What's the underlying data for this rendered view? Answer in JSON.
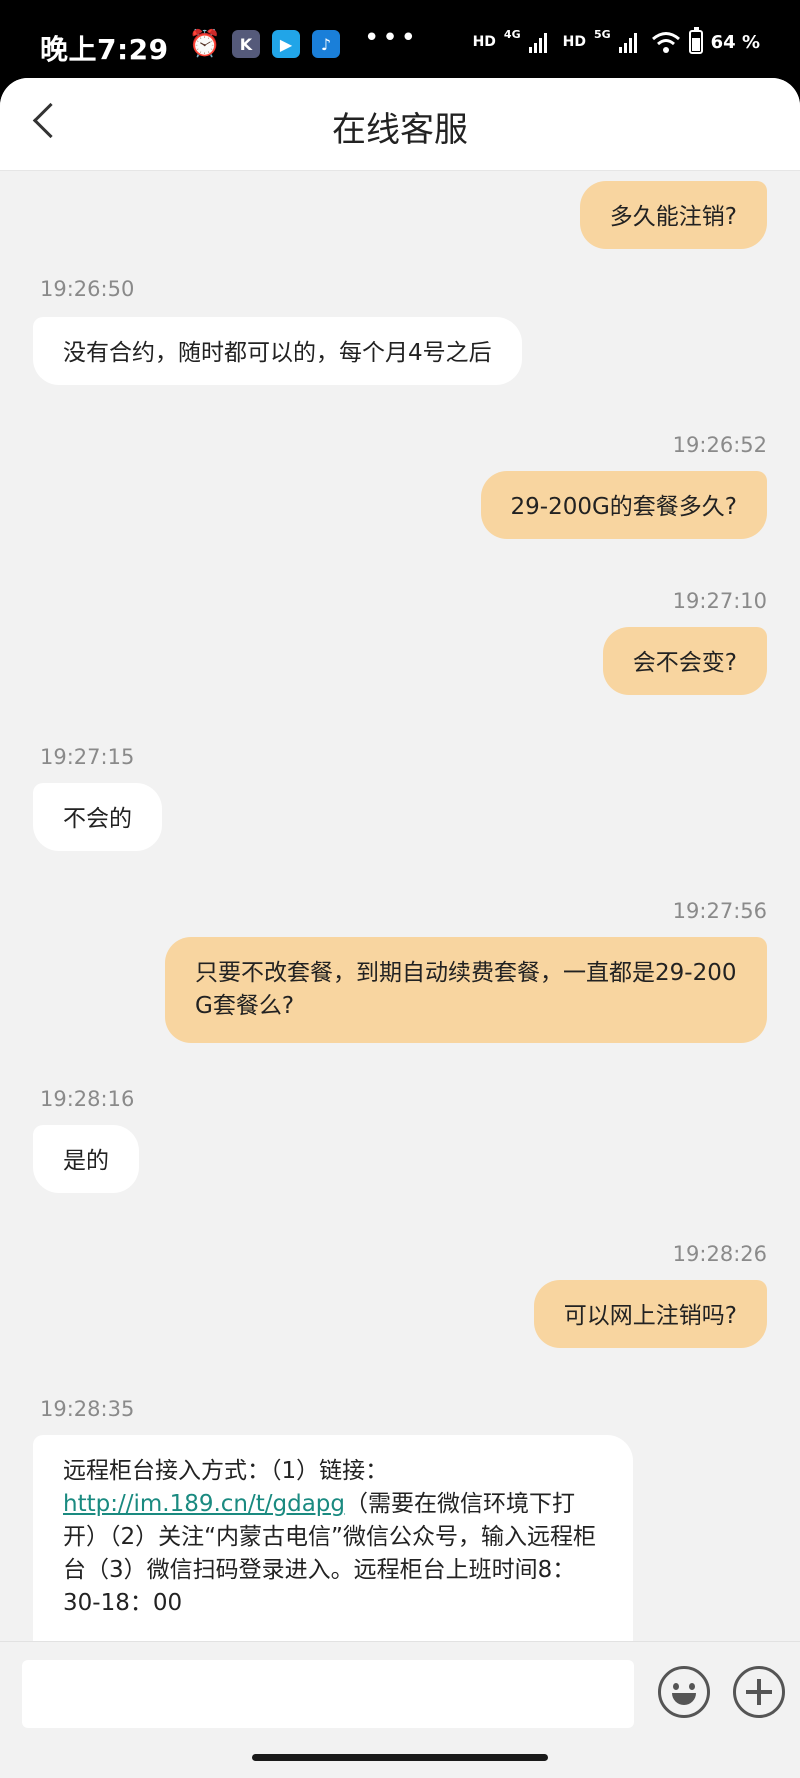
{
  "status_bar": {
    "time": "晚上7:29",
    "dots": "•••",
    "net1_label": "HD",
    "net1_type": "4G",
    "net2_label": "HD",
    "net2_type": "5G",
    "battery_text": "64 %",
    "battery_level": 0.64
  },
  "header": {
    "title": "在线客服"
  },
  "messages": [
    {
      "side": "out",
      "text": "多久能注销?"
    },
    {
      "side": "in",
      "time": "19:26:50",
      "text": "没有合约，随时都可以的，每个月4号之后"
    },
    {
      "side": "out",
      "time": "19:26:52",
      "text": "29-200G的套餐多久?"
    },
    {
      "side": "out",
      "time": "19:27:10",
      "text": "会不会变?"
    },
    {
      "side": "in",
      "time": "19:27:15",
      "text": "不会的"
    },
    {
      "side": "out",
      "time": "19:27:56",
      "text": "只要不改套餐，到期自动续费套餐，一直都是29-200 G套餐么?"
    },
    {
      "side": "in",
      "time": "19:28:16",
      "text": "是的"
    },
    {
      "side": "out",
      "time": "19:28:26",
      "text": "可以网上注销吗?"
    },
    {
      "side": "in",
      "time": "19:28:35",
      "text_before": "远程柜台接入方式：（1）链接：",
      "link": "http://im.189.cn/t/gdapg",
      "text_after": "（需要在微信环境下打开）（2）关注“内蒙古电信”微信公众号，输入远程柜台（3）微信扫码登录进入。远程柜台上班时间8：30-18：00"
    }
  ],
  "input": {
    "value": "",
    "placeholder": ""
  }
}
